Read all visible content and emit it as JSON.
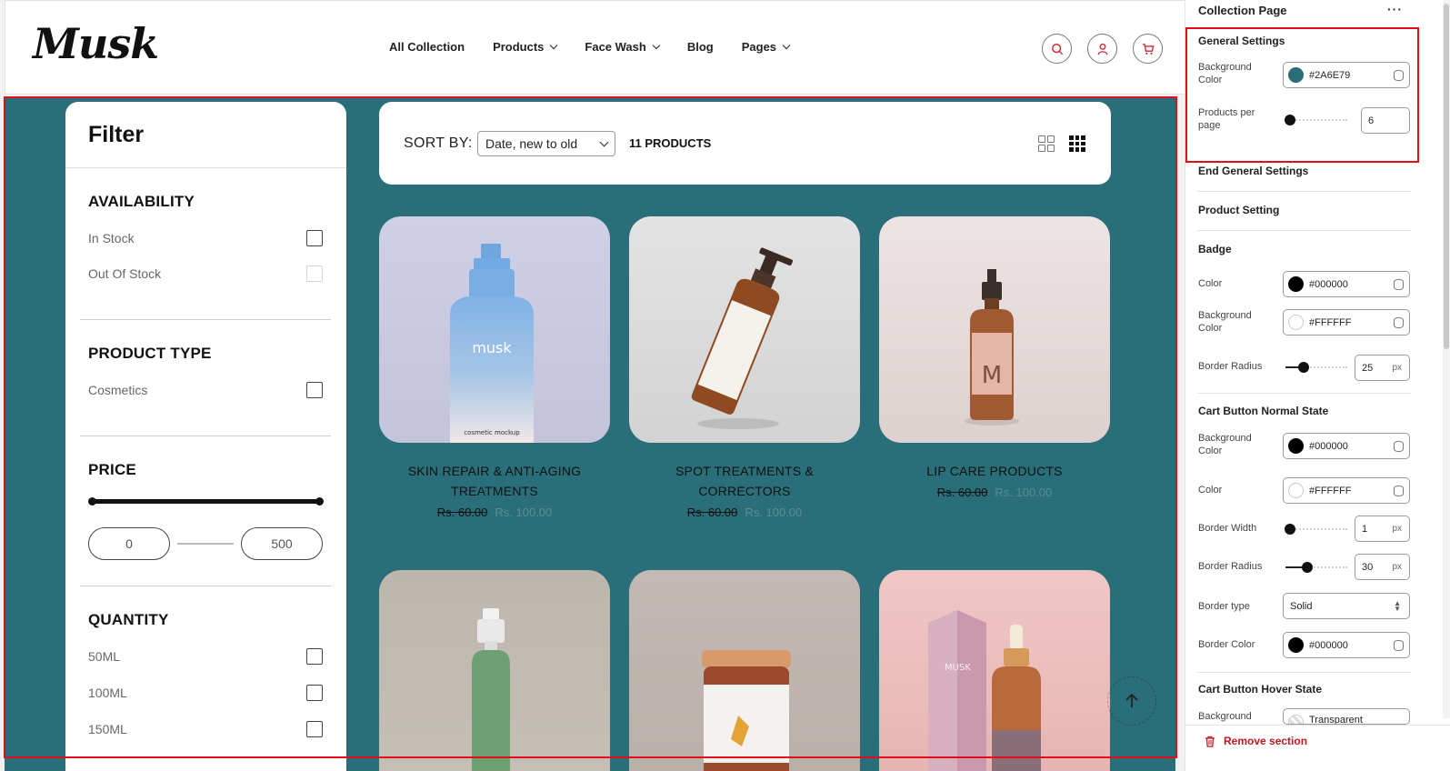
{
  "store": {
    "logo": "Musk",
    "nav": [
      {
        "label": "All Collection",
        "dropdown": false
      },
      {
        "label": "Products",
        "dropdown": true
      },
      {
        "label": "Face Wash",
        "dropdown": true
      },
      {
        "label": "Blog",
        "dropdown": false
      },
      {
        "label": "Pages",
        "dropdown": true
      }
    ],
    "icons": [
      "search-icon",
      "user-icon",
      "cart-icon"
    ],
    "accent": "#E0101A",
    "section_bg": "#2A6E79"
  },
  "filter": {
    "title": "Filter",
    "availability": {
      "heading": "AVAILABILITY",
      "options": [
        {
          "label": "In Stock",
          "disabled": false
        },
        {
          "label": "Out Of Stock",
          "disabled": true
        }
      ]
    },
    "product_type": {
      "heading": "PRODUCT TYPE",
      "options": [
        {
          "label": "Cosmetics"
        }
      ]
    },
    "price": {
      "heading": "PRICE",
      "min": "0",
      "max": "500"
    },
    "quantity": {
      "heading": "QUANTITY",
      "options": [
        {
          "label": "50ML"
        },
        {
          "label": "100ML"
        },
        {
          "label": "150ML"
        }
      ]
    }
  },
  "sortbar": {
    "label": "SORT BY:",
    "selected": "Date, new to old",
    "count": "11 PRODUCTS"
  },
  "products": [
    {
      "title": "SKIN REPAIR & ANTI-AGING TREATMENTS",
      "old_price": "Rs. 60.00",
      "price": "Rs. 100.00",
      "image": "blue-spray-bottle",
      "bottle_text": "musk",
      "label_text": "cosmetic mockup"
    },
    {
      "title": "SPOT TREATMENTS & CORRECTORS",
      "old_price": "Rs. 60.00",
      "price": "Rs. 100.00",
      "image": "amber-pump-bottle"
    },
    {
      "title": "LIP CARE PRODUCTS",
      "old_price": "Rs. 60.00",
      "price": "Rs. 100.00",
      "image": "pink-spray-bottle",
      "bottle_text": "M"
    },
    {
      "title": "",
      "image": "green-spray-bottle"
    },
    {
      "title": "",
      "image": "amber-jar"
    },
    {
      "title": "",
      "image": "dropper-and-box",
      "bottle_text": "MUSK"
    }
  ],
  "editor": {
    "title": "Collection Page",
    "more": "···",
    "general": {
      "heading": "General Settings",
      "bg_label": "Background Color",
      "bg_value": "#2A6E79",
      "per_page_label": "Products per page",
      "per_page_value": "6",
      "end_label": "End General Settings"
    },
    "product_setting": "Product Setting",
    "badge": {
      "heading": "Badge",
      "color_label": "Color",
      "color_value": "#000000",
      "bg_label": "Background Color",
      "bg_value": "#FFFFFF",
      "radius_label": "Border Radius",
      "radius_value": "25",
      "unit": "px"
    },
    "cart_normal": {
      "heading": "Cart Button Normal State",
      "bg_label": "Background Color",
      "bg_value": "#000000",
      "color_label": "Color",
      "color_value": "#FFFFFF",
      "width_label": "Border Width",
      "width_value": "1",
      "radius_label": "Border Radius",
      "radius_value": "30",
      "type_label": "Border type",
      "type_value": "Solid",
      "bcolor_label": "Border Color",
      "bcolor_value": "#000000",
      "unit": "px"
    },
    "cart_hover": {
      "heading": "Cart Button Hover State",
      "bg_label": "Background",
      "bg_value": "Transparent"
    },
    "remove": "Remove section"
  },
  "scroll_top": {
    "text": "SCROLL TO TOP"
  }
}
